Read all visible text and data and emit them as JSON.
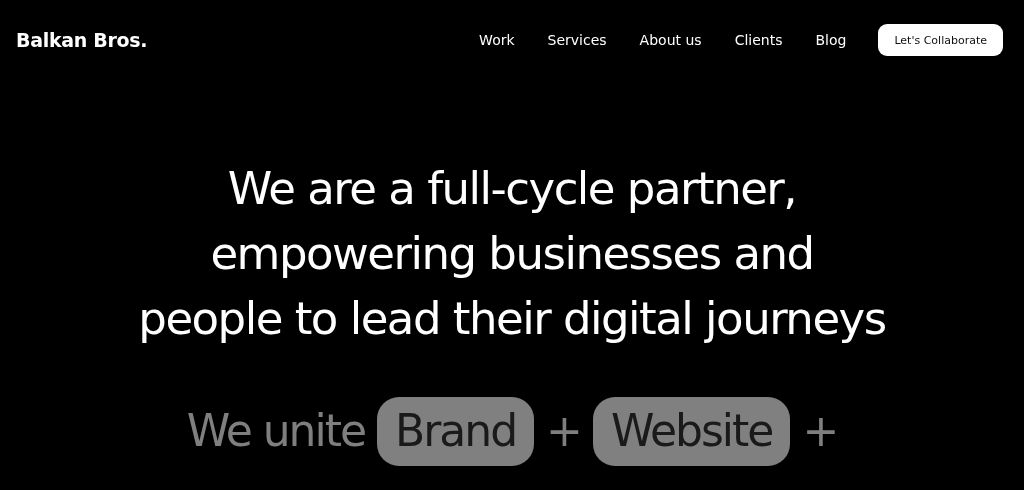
{
  "header": {
    "logo": "Balkan Bros.",
    "nav": [
      {
        "label": "Work"
      },
      {
        "label": "Services"
      },
      {
        "label": "About us"
      },
      {
        "label": "Clients"
      },
      {
        "label": "Blog"
      }
    ],
    "cta": "Let's Collaborate"
  },
  "hero": {
    "headline": [
      "We are a full-cycle partner,",
      "empowering businesses and",
      "people to lead their digital journeys"
    ]
  },
  "tagline": [
    {
      "kind": "text",
      "text": "We unite"
    },
    {
      "kind": "pill",
      "text": "Brand"
    },
    {
      "kind": "text",
      "text": "+"
    },
    {
      "kind": "pill",
      "text": "Website"
    },
    {
      "kind": "text",
      "text": "+"
    }
  ]
}
